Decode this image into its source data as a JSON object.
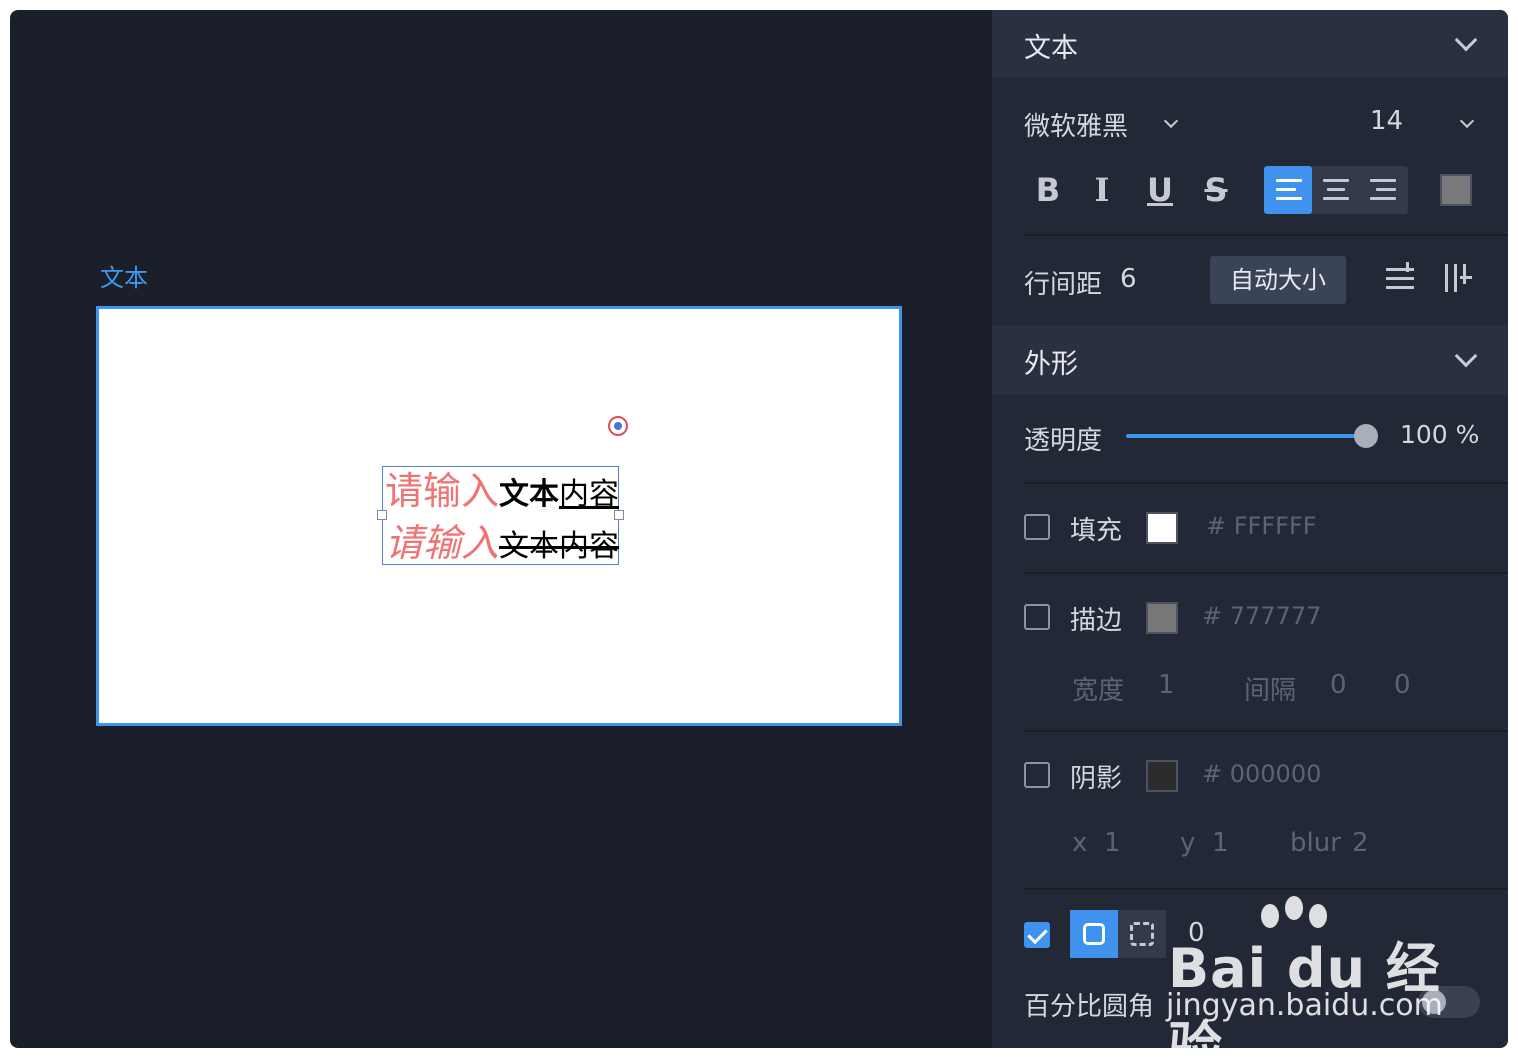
{
  "canvas": {
    "label": "文本",
    "text_lines": [
      {
        "pink": "请输入",
        "bold": "文本",
        "underline": "内容"
      },
      {
        "pink": "请输入",
        "strike": "文本内容"
      }
    ]
  },
  "text_section": {
    "title": "文本",
    "font_family": "微软雅黑",
    "font_size": "14",
    "bold_label": "B",
    "italic_label": "I",
    "underline_label": "U",
    "strike_label": "S",
    "align_selected": "left",
    "color": "#777777",
    "line_spacing_label": "行间距",
    "line_spacing_value": "6",
    "auto_size_label": "自动大小"
  },
  "appearance_section": {
    "title": "外形",
    "opacity_label": "透明度",
    "opacity_value": "100 %",
    "opacity": 1.0,
    "fill": {
      "label": "填充",
      "hex": "# FFFFFF",
      "color": "#FFFFFF",
      "checked": false
    },
    "stroke": {
      "label": "描边",
      "hex": "# 777777",
      "color": "#777777",
      "checked": false,
      "width_label": "宽度",
      "width_value": "1",
      "gap_label": "间隔",
      "gap_value1": "0",
      "gap_value2": "0"
    },
    "shadow": {
      "label": "阴影",
      "hex": "# 000000",
      "color": "#000000",
      "checked": false,
      "x_label": "x",
      "x_value": "1",
      "y_label": "y",
      "y_value": "1",
      "blur_label": "blur",
      "blur_value": "2"
    },
    "radius": {
      "checked": true,
      "value": "0",
      "percent_label": "百分比圆角",
      "percent_on": false
    }
  },
  "watermark": {
    "line1": "Bai du 经验",
    "line2": "jingyan.baidu.com"
  },
  "colors": {
    "accent": "#3f92ee",
    "background": "#1b1f29",
    "panel": "#232836"
  }
}
